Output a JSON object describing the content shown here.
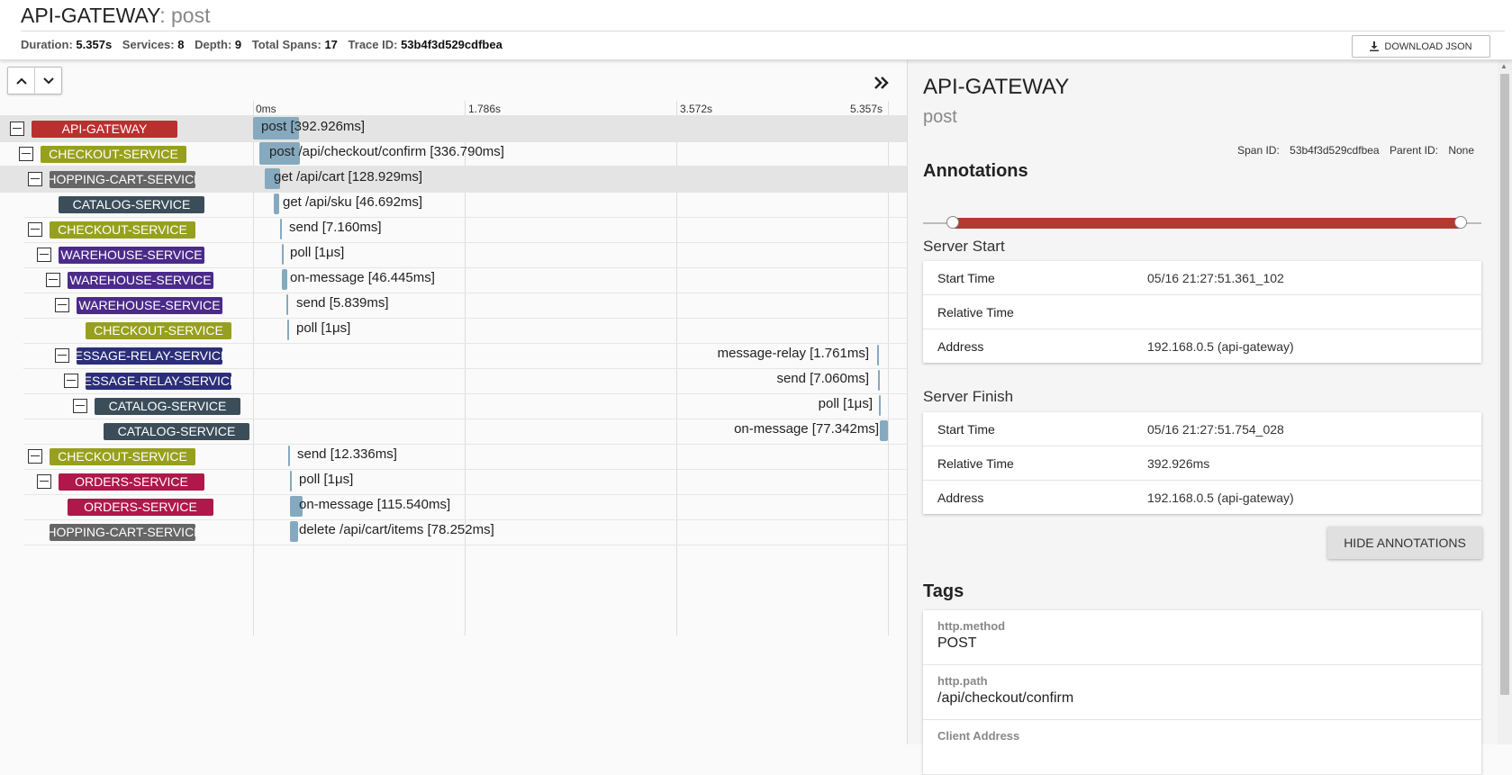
{
  "header": {
    "service": "API-GATEWAY",
    "separator": ": ",
    "operation": "post",
    "duration_label": "Duration:",
    "duration": "5.357s",
    "services_label": "Services:",
    "services": "8",
    "depth_label": "Depth:",
    "depth": "9",
    "spans_label": "Total Spans:",
    "spans": "17",
    "trace_label": "Trace ID:",
    "trace_id": "53b4f3d529cdfbea",
    "download_label": "DOWNLOAD JSON",
    "download_icon": "download-icon"
  },
  "timeline": {
    "ticks": [
      "0ms",
      "1.786s",
      "3.572s",
      "5.357s"
    ],
    "collapse_icon": "double-chevron-right-icon",
    "up_icon": "chevron-up-icon",
    "down_icon": "chevron-down-icon",
    "rows": [
      {
        "service": "API-GATEWAY",
        "color": "#b8312f",
        "label": "post [392.926ms]",
        "depth": 0
      },
      {
        "service": "CHECKOUT-SERVICE",
        "color": "#97a01e",
        "label": "post /api/checkout/confirm [336.790ms]",
        "depth": 1
      },
      {
        "service": "SHOPPING-CART-SERVICE",
        "color": "#666666",
        "label": "get /api/cart [128.929ms]",
        "depth": 2
      },
      {
        "service": "CATALOG-SERVICE",
        "color": "#3b4d59",
        "label": "get /api/sku [46.692ms]",
        "depth": 3
      },
      {
        "service": "CHECKOUT-SERVICE",
        "color": "#97a01e",
        "label": "send [7.160ms]",
        "depth": 2
      },
      {
        "service": "WAREHOUSE-SERVICE",
        "color": "#4b2a8a",
        "label": "poll [1μs]",
        "depth": 3
      },
      {
        "service": "WAREHOUSE-SERVICE",
        "color": "#4b2a8a",
        "label": "on-message [46.445ms]",
        "depth": 4
      },
      {
        "service": "WAREHOUSE-SERVICE",
        "color": "#4b2a8a",
        "label": "send [5.839ms]",
        "depth": 5
      },
      {
        "service": "CHECKOUT-SERVICE",
        "color": "#97a01e",
        "label": "poll [1μs]",
        "depth": 6
      },
      {
        "service": "MESSAGE-RELAY-SERVICE",
        "color": "#2b2e78",
        "label": "message-relay [1.761ms]",
        "depth": 5
      },
      {
        "service": "MESSAGE-RELAY-SERVICE",
        "color": "#2b2e78",
        "label": "send [7.060ms]",
        "depth": 6
      },
      {
        "service": "CATALOG-SERVICE",
        "color": "#3b4d59",
        "label": "poll [1μs]",
        "depth": 7
      },
      {
        "service": "CATALOG-SERVICE",
        "color": "#3b4d59",
        "label": "on-message [77.342ms]",
        "depth": 8
      },
      {
        "service": "CHECKOUT-SERVICE",
        "color": "#97a01e",
        "label": "send [12.336ms]",
        "depth": 2
      },
      {
        "service": "ORDERS-SERVICE",
        "color": "#b0174a",
        "label": "poll [1μs]",
        "depth": 3
      },
      {
        "service": "ORDERS-SERVICE",
        "color": "#b0174a",
        "label": "on-message [115.540ms]",
        "depth": 4
      },
      {
        "service": "SHOPPING-CART-SERVICE",
        "color": "#666666",
        "label": "delete /api/cart/items [78.252ms]",
        "depth": 2
      }
    ]
  },
  "detail": {
    "service": "API-GATEWAY",
    "operation": "post",
    "span_id_label": "Span ID:",
    "span_id": "53b4f3d529cdfbea",
    "parent_id_label": "Parent ID:",
    "parent_id": "None",
    "annotations_heading": "Annotations",
    "annotation_color": "#b23a31",
    "server_start": {
      "heading": "Server Start",
      "rows": [
        {
          "key": "Start Time",
          "value": "05/16 21:27:51.361_102"
        },
        {
          "key": "Relative Time",
          "value": ""
        },
        {
          "key": "Address",
          "value": "192.168.0.5 (api-gateway)"
        }
      ]
    },
    "server_finish": {
      "heading": "Server Finish",
      "rows": [
        {
          "key": "Start Time",
          "value": "05/16 21:27:51.754_028"
        },
        {
          "key": "Relative Time",
          "value": "392.926ms"
        },
        {
          "key": "Address",
          "value": "192.168.0.5 (api-gateway)"
        }
      ]
    },
    "hide_annotations_label": "HIDE ANNOTATIONS",
    "tags_heading": "Tags",
    "tags": [
      {
        "key": "http.method",
        "value": "POST"
      },
      {
        "key": "http.path",
        "value": "/api/checkout/confirm"
      },
      {
        "key": "Client Address",
        "value": ""
      }
    ]
  }
}
